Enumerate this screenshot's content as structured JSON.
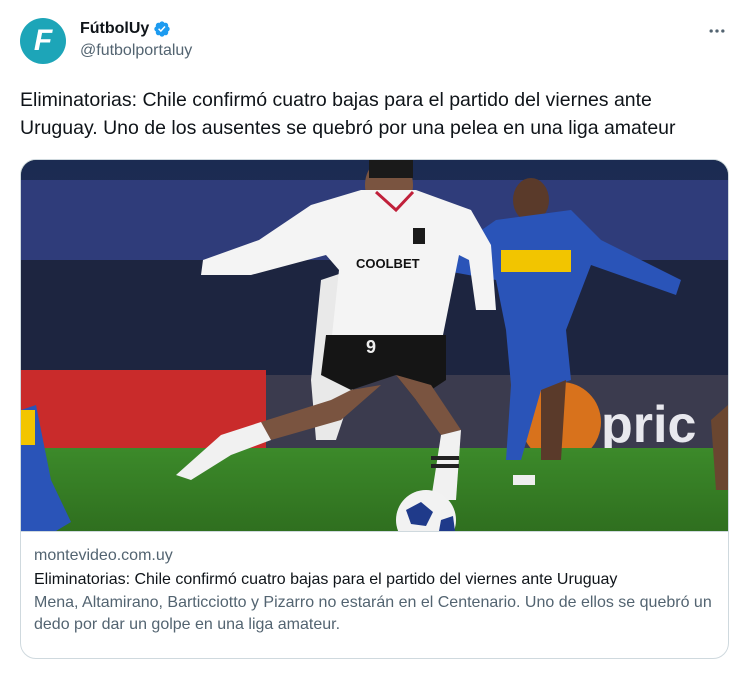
{
  "author": {
    "avatar_letter": "F",
    "display_name": "FútbolUy",
    "handle": "@futbolportaluy",
    "verified_icon": "verified-badge-icon",
    "avatar_color": "#1da5b8",
    "verified_color": "#1d9bf0"
  },
  "more_icon": "more-horizontal-icon",
  "tweet": {
    "text": "Eliminatorias: Chile confirmó cuatro bajas para el partido del viernes ante Uruguay. Uno de los ausentes se quebró por una pelea en una liga amateur"
  },
  "card": {
    "image_jersey_text": "COOLBET",
    "image_board_text": "pric",
    "image_number": "9",
    "domain": "montevideo.com.uy",
    "title": "Eliminatorias: Chile confirmó cuatro bajas para el partido del viernes ante Uruguay",
    "description": "Mena, Altamirano, Barticciotto y Pizarro no estarán en el Centenario. Uno de ellos se quebró un dedo por dar un golpe en una liga amateur."
  }
}
